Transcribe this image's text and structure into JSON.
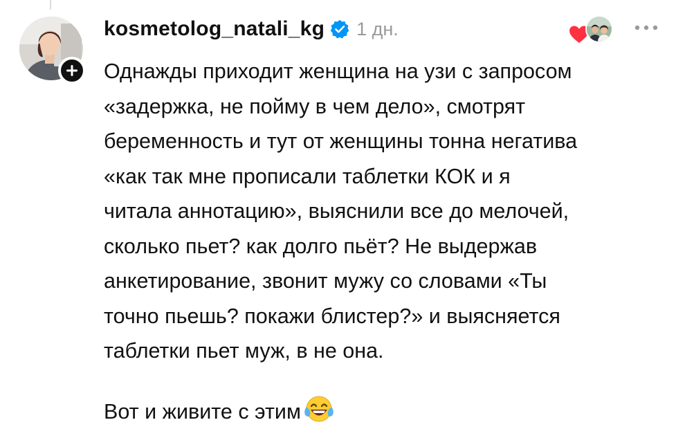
{
  "comment": {
    "username": "kosmetolog_natali_kg",
    "verified": true,
    "time": "1 дн.",
    "text_paragraph_1": "Однажды приходит женщина на узи с запросом\n«задержка, не пойму в чем дело», смотрят\nбеременность и тут от женщины тонна негатива\n«как так мне прописали таблетки КОК и я\nчитала аннотацию», выяснили все до мелочей,\nсколько пьет? как долго пьёт? Не выдержав\nанкетирование, звонит мужу со словами «Ты\nточно пьешь? покажи блистер?» и выясняется\nтаблетки пьет муж, в не она.",
    "text_paragraph_2": "Вот и живите с этим",
    "emoji": "face-with-tears-of-joy",
    "avatar_icon": "user-avatar",
    "follow_icon": "plus-icon",
    "verified_icon": "verified-badge-icon",
    "reaction_icon": "heart-icon",
    "more_icon": "more-horizontal-icon"
  },
  "colors": {
    "verified_blue": "#0095f6",
    "heart_red": "#ff3040",
    "timestamp_gray": "#9a9a9a",
    "text": "#111111",
    "emoji_yellow": "#ffcc33"
  }
}
